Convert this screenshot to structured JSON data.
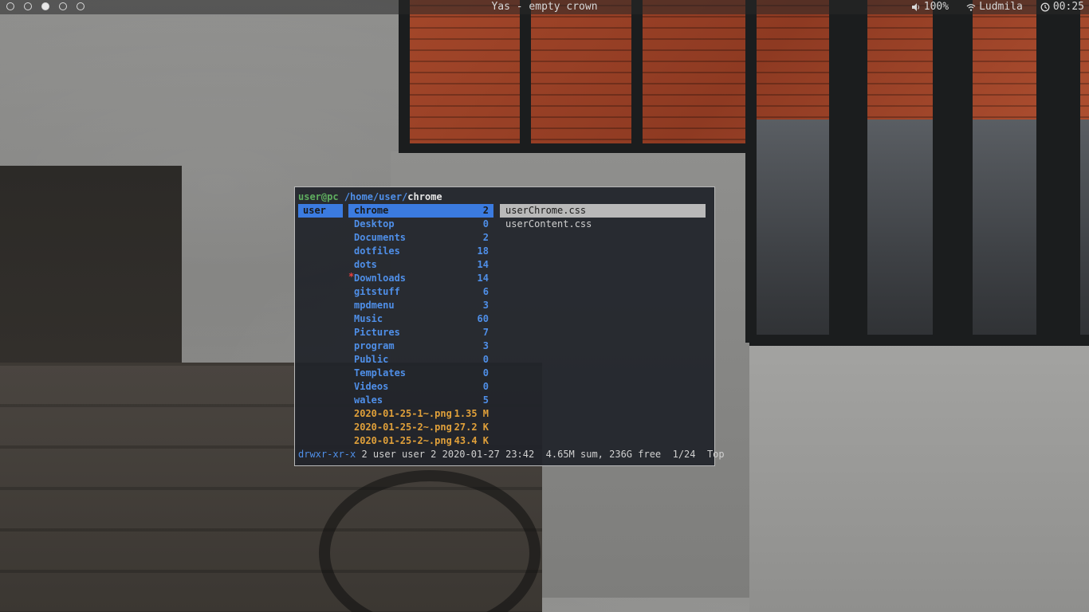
{
  "topbar": {
    "workspaces": [
      {
        "active": false
      },
      {
        "active": false
      },
      {
        "active": true
      },
      {
        "active": false
      },
      {
        "active": false
      }
    ],
    "window_title": "Yas - empty crown",
    "volume": "100%",
    "wifi": "Ludmila",
    "clock": "00:25"
  },
  "ranger": {
    "header": {
      "user": "user@pc",
      "path": "/home/user/",
      "current": "chrome"
    },
    "parent": [
      {
        "name": "user",
        "selected": true
      }
    ],
    "current_dir": [
      {
        "name": "chrome",
        "size": "2",
        "selected": true,
        "type": "dir"
      },
      {
        "name": "Desktop",
        "size": "0",
        "type": "dir"
      },
      {
        "name": "Documents",
        "size": "2",
        "type": "dir"
      },
      {
        "name": "dotfiles",
        "size": "18",
        "type": "dir"
      },
      {
        "name": "dots",
        "size": "14",
        "type": "dir"
      },
      {
        "name": "Downloads",
        "size": "14",
        "type": "dir",
        "marked": true,
        "mark": "*"
      },
      {
        "name": "gitstuff",
        "size": "6",
        "type": "dir"
      },
      {
        "name": "mpdmenu",
        "size": "3",
        "type": "dir"
      },
      {
        "name": "Music",
        "size": "60",
        "type": "dir"
      },
      {
        "name": "Pictures",
        "size": "7",
        "type": "dir"
      },
      {
        "name": "program",
        "size": "3",
        "type": "dir"
      },
      {
        "name": "Public",
        "size": "0",
        "type": "dir"
      },
      {
        "name": "Templates",
        "size": "0",
        "type": "dir"
      },
      {
        "name": "Videos",
        "size": "0",
        "type": "dir"
      },
      {
        "name": "wales",
        "size": "5",
        "type": "dir"
      },
      {
        "name": "2020-01-25-1~.png",
        "size": "1.35 M",
        "type": "file"
      },
      {
        "name": "2020-01-25-2~.png",
        "size": "27.2 K",
        "type": "file"
      },
      {
        "name": "2020-01-25-2~.png",
        "size": "43.4 K",
        "type": "file"
      }
    ],
    "preview": [
      {
        "name": "userChrome.css",
        "selected": true
      },
      {
        "name": "userContent.css"
      }
    ],
    "status": {
      "permissions": "drwxr-xr-x",
      "info": " 2 user user 2 2020-01-27 23:42  4.65M sum, 236G free  1/24  Top"
    }
  }
}
